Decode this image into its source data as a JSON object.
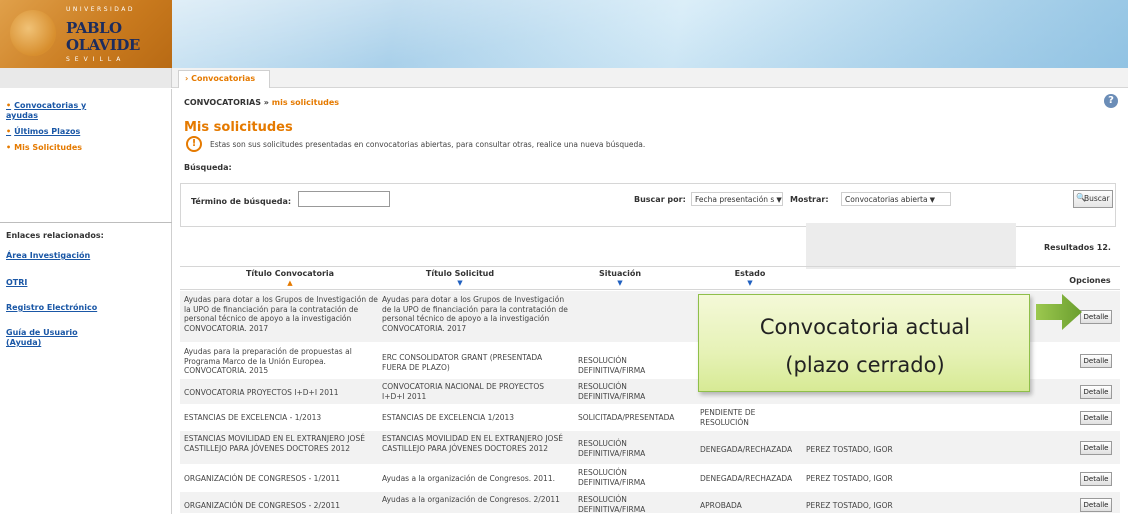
{
  "header": {
    "logo_top": "UNIVERSIDAD",
    "logo_name1": "PABLO",
    "logo_name2": "OLAVIDE",
    "logo_bottom": "SEVILLA"
  },
  "tabs": [
    {
      "label": "› Convocatorias"
    }
  ],
  "sidebar": {
    "items": [
      {
        "label": "Convocatorias y ayudas"
      },
      {
        "label": "Últimos Plazos"
      },
      {
        "label": "Mis Solicitudes"
      }
    ],
    "related_title": "Enlaces relacionados:",
    "related_links": [
      {
        "label": "Área Investigación"
      },
      {
        "label": "OTRI"
      },
      {
        "label": "Registro Electrónico"
      },
      {
        "label": "Guía de Usuario (Ayuda)"
      }
    ]
  },
  "breadcrumb": {
    "parent": "CONVOCATORIAS »",
    "current": "mis solicitudes"
  },
  "page_title": "Mis solicitudes",
  "info_text": "Estas son sus solicitudes presentadas en convocatorias abiertas, para consultar otras, realice una nueva búsqueda.",
  "busqueda_label": "Búsqueda:",
  "search": {
    "term_label": "Término de búsqueda:",
    "term_value": "",
    "buscar_por_label": "Buscar por:",
    "buscar_por_value": "Fecha presentación s",
    "mostrar_label": "Mostrar:",
    "mostrar_value": "Convocatorias abierta",
    "button_label": "Buscar"
  },
  "results_text": "Resultados 12.",
  "table": {
    "headers": [
      {
        "label": "Título Convocatoria"
      },
      {
        "label": "Título Solicitud"
      },
      {
        "label": "Situación"
      },
      {
        "label": "Estado"
      },
      {
        "label": "Opciones"
      }
    ],
    "rows": [
      {
        "convocatoria": "Ayudas para dotar a los Grupos de Investigación de la UPO de financiación para la contratación de personal técnico de apoyo a la investigación CONVOCATORIA. 2017",
        "solicitud": "Ayudas para dotar a los Grupos de Investigación de la UPO de financiación para la contratación de personal técnico de apoyo a la investigación CONVOCATORIA. 2017",
        "situacion": "",
        "estado": "",
        "extra": "",
        "opciones": "Detalle"
      },
      {
        "convocatoria": "Ayudas para la preparación de propuestas al Programa Marco de la Unión Europea. CONVOCATORIA. 2015",
        "solicitud": "ERC CONSOLIDATOR GRANT (PRESENTADA FUERA DE PLAZO)",
        "situacion": "RESOLUCIÓN DEFINITIVA/FIRMA",
        "estado": "",
        "extra": "",
        "opciones": "Detalle"
      },
      {
        "convocatoria": "CONVOCATORIA PROYECTOS I+D+I 2011",
        "solicitud": "CONVOCATORIA NACIONAL DE PROYECTOS I+D+I 2011",
        "situacion": "RESOLUCIÓN DEFINITIVA/FIRMA",
        "estado": "",
        "extra": "",
        "opciones": "Detalle"
      },
      {
        "convocatoria": "ESTANCIAS DE EXCELENCIA - 1/2013",
        "solicitud": "ESTANCIAS DE EXCELENCIA 1/2013",
        "situacion": "SOLICITADA/PRESENTADA",
        "estado": "PENDIENTE DE RESOLUCIÓN",
        "extra": "",
        "opciones": "Detalle"
      },
      {
        "convocatoria": "ESTANCIAS MOVILIDAD EN EL EXTRANJERO JOSÉ CASTILLEJO PARA JÓVENES DOCTORES 2012",
        "solicitud": "ESTANCIAS MOVILIDAD EN EL EXTRANJERO JOSÉ CASTILLEJO PARA JÓVENES DOCTORES 2012",
        "situacion": "RESOLUCIÓN DEFINITIVA/FIRMA",
        "estado": "DENEGADA/RECHAZADA",
        "extra": "PEREZ TOSTADO, IGOR",
        "opciones": "Detalle"
      },
      {
        "convocatoria": "ORGANIZACIÓN DE CONGRESOS - 1/2011",
        "solicitud": "Ayudas a la organización de Congresos. 2011.",
        "situacion": "RESOLUCIÓN DEFINITIVA/FIRMA",
        "estado": "DENEGADA/RECHAZADA",
        "extra": "PEREZ TOSTADO, IGOR",
        "opciones": "Detalle"
      },
      {
        "convocatoria": "ORGANIZACIÓN DE CONGRESOS - 2/2011",
        "solicitud": "Ayudas a la organización de Congresos. 2/2011",
        "situacion": "RESOLUCIÓN DEFINITIVA/FIRMA",
        "estado": "APROBADA",
        "extra": "PEREZ TOSTADO, IGOR",
        "opciones": "Detalle"
      }
    ]
  },
  "callout": {
    "line1": "Convocatoria actual",
    "line2": "(plazo cerrado)"
  },
  "colors": {
    "accent": "#e57a00",
    "link": "#1a57a6",
    "callout_bg": "#e6f2b6",
    "arrow": "#7fb03a"
  }
}
